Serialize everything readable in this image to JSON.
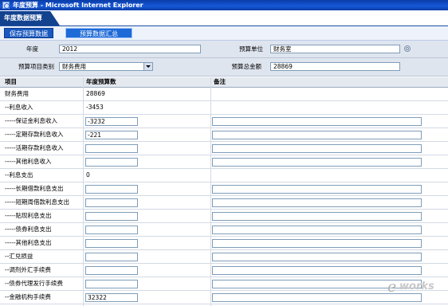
{
  "window": {
    "title": "年度预算 - Microsoft Internet Explorer"
  },
  "tab": {
    "label": "年度数据预算"
  },
  "toolbar": {
    "save_label": "保存预算数据",
    "summary_label": "预算数据汇总"
  },
  "form": {
    "year_label": "年度",
    "year_value": "2012",
    "unit_label": "预算单位",
    "unit_value": "财务室",
    "category_label": "预算项目类别",
    "category_value": "财务费用",
    "total_label": "预算总金额",
    "total_value": "28869"
  },
  "table": {
    "columns": {
      "item": "项目",
      "amount": "年度预算数",
      "note": "备注"
    },
    "rows": [
      {
        "name": "财务费用",
        "amount": "28869",
        "editable": false
      },
      {
        "name": "--利息收入",
        "amount": "-3453",
        "editable": false
      },
      {
        "name": "-----保证金利息收入",
        "amount": "-3232",
        "editable": true
      },
      {
        "name": "-----定期存款利息收入",
        "amount": "-221",
        "editable": true
      },
      {
        "name": "-----活期存款利息收入",
        "amount": "",
        "editable": true
      },
      {
        "name": "-----其他利息收入",
        "amount": "",
        "editable": true
      },
      {
        "name": "--利息支出",
        "amount": "0",
        "editable": false
      },
      {
        "name": "-----长期借款利息支出",
        "amount": "",
        "editable": true
      },
      {
        "name": "-----短期周借款利息支出",
        "amount": "",
        "editable": true
      },
      {
        "name": "-----贴现利息支出",
        "amount": "",
        "editable": true
      },
      {
        "name": "-----债券利息支出",
        "amount": "",
        "editable": true
      },
      {
        "name": "-----其他利息支出",
        "amount": "",
        "editable": true
      },
      {
        "name": "--汇兑损益",
        "amount": "",
        "editable": true
      },
      {
        "name": "--调剂外汇手续费",
        "amount": "",
        "editable": true
      },
      {
        "name": "--债券代理发行手续费",
        "amount": "",
        "editable": true
      },
      {
        "name": "--金融机构手续费",
        "amount": "32322",
        "editable": true
      }
    ]
  },
  "watermark": {
    "letter": "e",
    "word": "works"
  }
}
